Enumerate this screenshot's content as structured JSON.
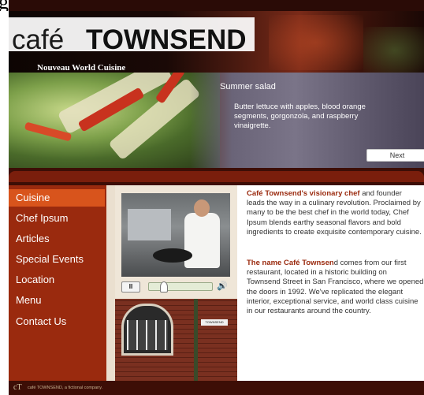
{
  "header": {
    "logo_cafe": "café",
    "logo_townsend": "TOWNSEND",
    "tagline": "Nouveau World Cuisine"
  },
  "hero": {
    "title": "Summer salad",
    "description": "Butter lettuce with apples, blood orange segments, gorgonzola, and raspberry vinaigrette.",
    "next_label": "Next"
  },
  "nav": {
    "items": [
      "Cuisine",
      "Chef Ipsum",
      "Articles",
      "Special Events",
      "Location",
      "Menu",
      "Contact Us"
    ],
    "active": "Cuisine"
  },
  "media": {
    "pause_label": "II",
    "volume_icon": "speaker-icon",
    "sign_text": "TOWNSEND",
    "progress": 0.2
  },
  "content": {
    "p1_highlight": "Café Townsend's visionary chef",
    "p1_lines": [
      " and founder",
      "leads the way in a culinary revolution. Proclaimed by",
      "many to be the best chef in the world today, Chef",
      "Ipsum blends earthy seasonal flavors and bold",
      "ingredients to create exquisite contemporary cuisine."
    ],
    "p2_highlight": "The name Café Townsen",
    "p2_lines": [
      "d comes from our first",
      "restaurant, located in a historic building on",
      "Townsend Street in San Francisco, where we opened",
      "the doors in 1992. We've replicated the elegant",
      "interior, exceptional service, and world class cuisine",
      "in our restaurants around the country."
    ]
  },
  "footer": {
    "logo": "cT",
    "text": "café TOWNSEND, a fictional company."
  },
  "colors": {
    "brand_dark": "#2a0b06",
    "nav_bg": "#9a2a0e",
    "nav_active": "#d8541c",
    "highlight": "#9a2a0e"
  }
}
